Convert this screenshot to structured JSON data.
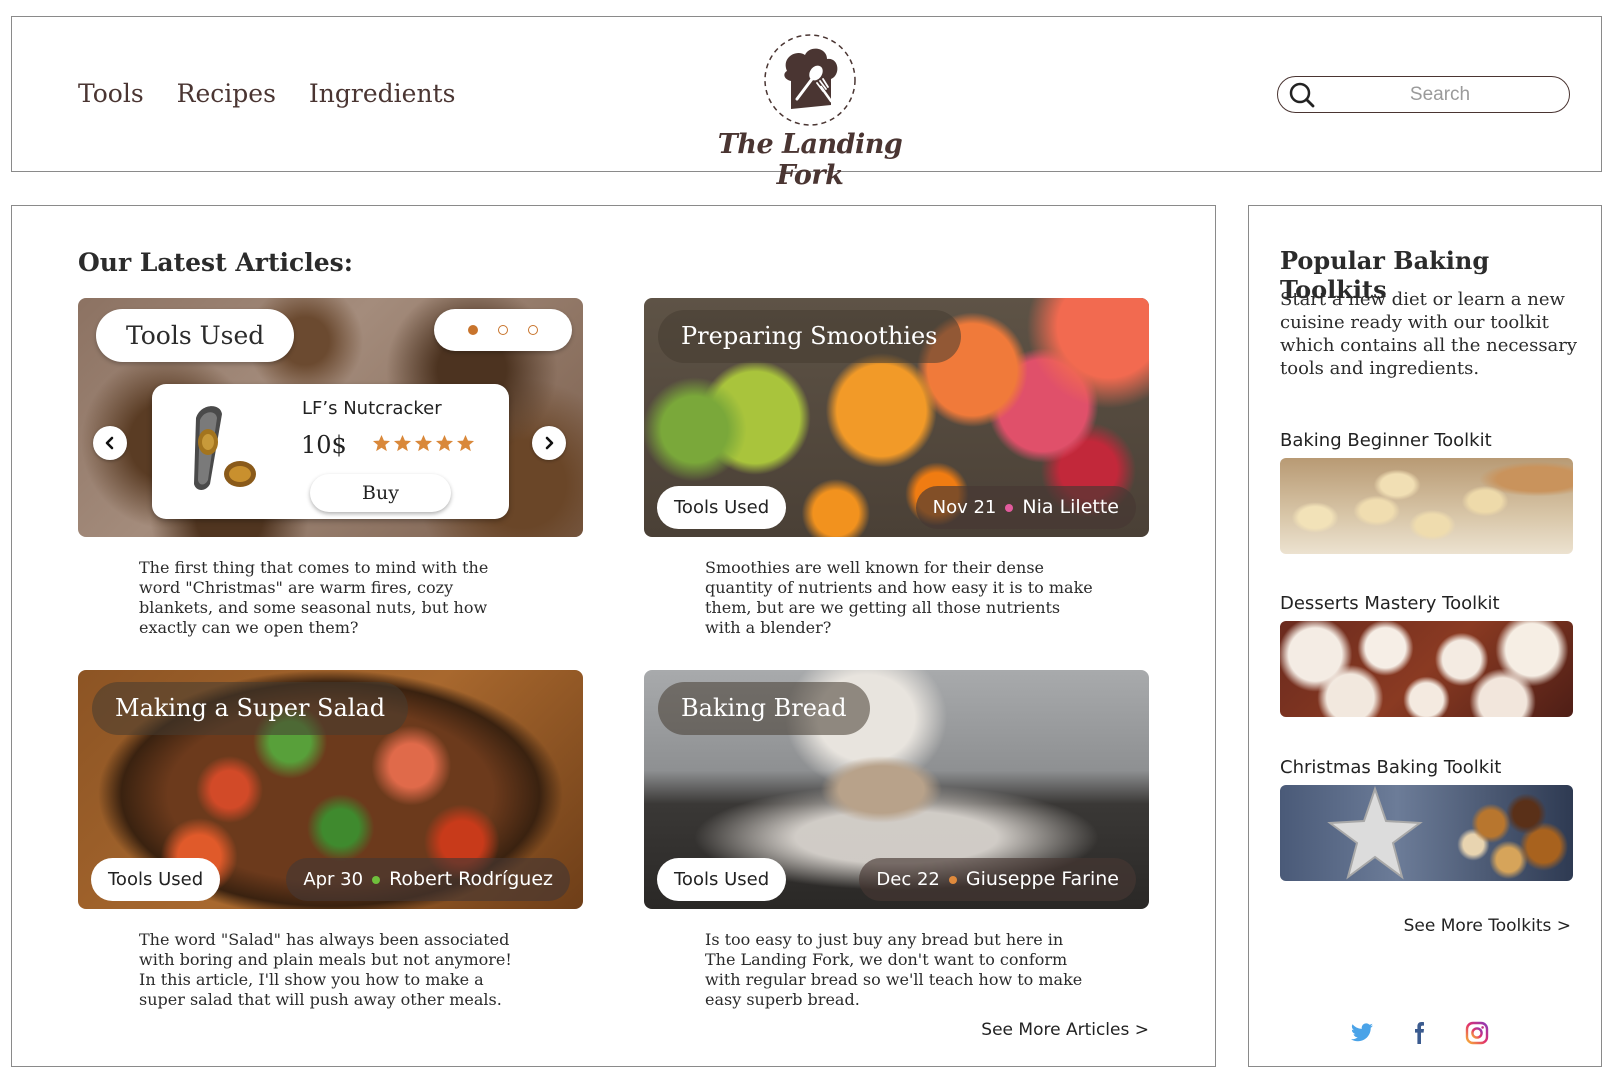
{
  "header": {
    "nav": [
      "Tools",
      "Recipes",
      "Ingredients"
    ],
    "brand": "The Landing Fork",
    "search_placeholder": "Search"
  },
  "main": {
    "section_title": "Our Latest Articles:",
    "featured": {
      "title": "Tools Used",
      "product_name": "LF’s Nutcracker",
      "price": "10$",
      "rating": 5,
      "buy_label": "Buy",
      "carousel_slides": 3,
      "carousel_active": 1,
      "excerpt": "The first thing that comes to mind with the word \"Christmas\" are warm fires, cozy blankets, and some seasonal nuts, but how exactly can we open them?"
    },
    "articles": [
      {
        "title": "Preparing Smoothies",
        "tools_label": "Tools Used",
        "date": "Nov 21",
        "author": "Nia Lilette",
        "dot_color": "#e25b9d",
        "excerpt": "Smoothies are well known for their dense quantity of nutrients and how easy it is to make them, but are we getting all those nutrients with a blender?"
      },
      {
        "title": "Making a Super Salad",
        "tools_label": "Tools Used",
        "date": "Apr 30",
        "author": "Robert Rodríguez",
        "dot_color": "#6fbf3c",
        "excerpt": "The word \"Salad\" has always been associated with boring and plain meals but not anymore! In this article, I'll show you how to make a super salad that will push away other meals."
      },
      {
        "title": "Baking Bread",
        "tools_label": "Tools Used",
        "date": "Dec 22",
        "author": "Giuseppe Farine",
        "dot_color": "#e08a3c",
        "excerpt": "Is too easy to just buy any bread but here in The Landing Fork, we don't want to conform with regular bread so we'll teach how to make easy superb bread."
      }
    ],
    "see_more": "See More Articles >"
  },
  "sidebar": {
    "title": "Popular Baking Toolkits",
    "description": "Start a new diet or learn a new cuisine ready with our toolkit which contains all the necessary tools and ingredients.",
    "toolkits": [
      {
        "name": "Baking Beginner Toolkit"
      },
      {
        "name": "Desserts Mastery Toolkit"
      },
      {
        "name": "Christmas Baking Toolkit"
      }
    ],
    "see_more": "See More Toolkits >",
    "socials": [
      "twitter-icon",
      "facebook-icon",
      "instagram-icon"
    ]
  },
  "colors": {
    "brand": "#4a3532",
    "accent": "#c8742c",
    "star": "#d9883a"
  }
}
